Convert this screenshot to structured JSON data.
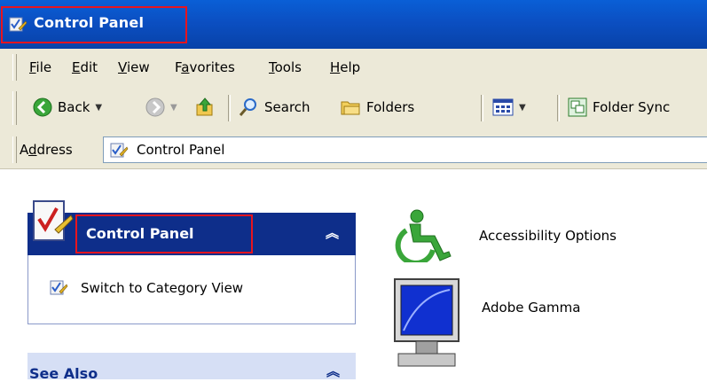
{
  "window": {
    "title": "Control Panel"
  },
  "menu": [
    {
      "label": "File",
      "accel": "F"
    },
    {
      "label": "Edit",
      "accel": "E"
    },
    {
      "label": "View",
      "accel": "V"
    },
    {
      "label": "Favorites",
      "accel": "a"
    },
    {
      "label": "Tools",
      "accel": "T"
    },
    {
      "label": "Help",
      "accel": "H"
    }
  ],
  "toolbar": {
    "back_label": "Back",
    "search_label": "Search",
    "folders_label": "Folders",
    "foldersync_label": "Folder Sync"
  },
  "address": {
    "label": "Address",
    "value": "Control Panel"
  },
  "sidebar": {
    "panel_title": "Control Panel",
    "switch_link": "Switch to Category View",
    "see_also": "See Also"
  },
  "items": [
    {
      "label": "Accessibility Options",
      "icon": "accessibility-icon"
    },
    {
      "label": "Adobe Gamma",
      "icon": "adobe-gamma-icon"
    }
  ],
  "colors": {
    "titlebar": "#0b4fc2",
    "panel_header": "#0e2e8a",
    "highlight": "#e8141e",
    "bar": "#ece9d8"
  }
}
